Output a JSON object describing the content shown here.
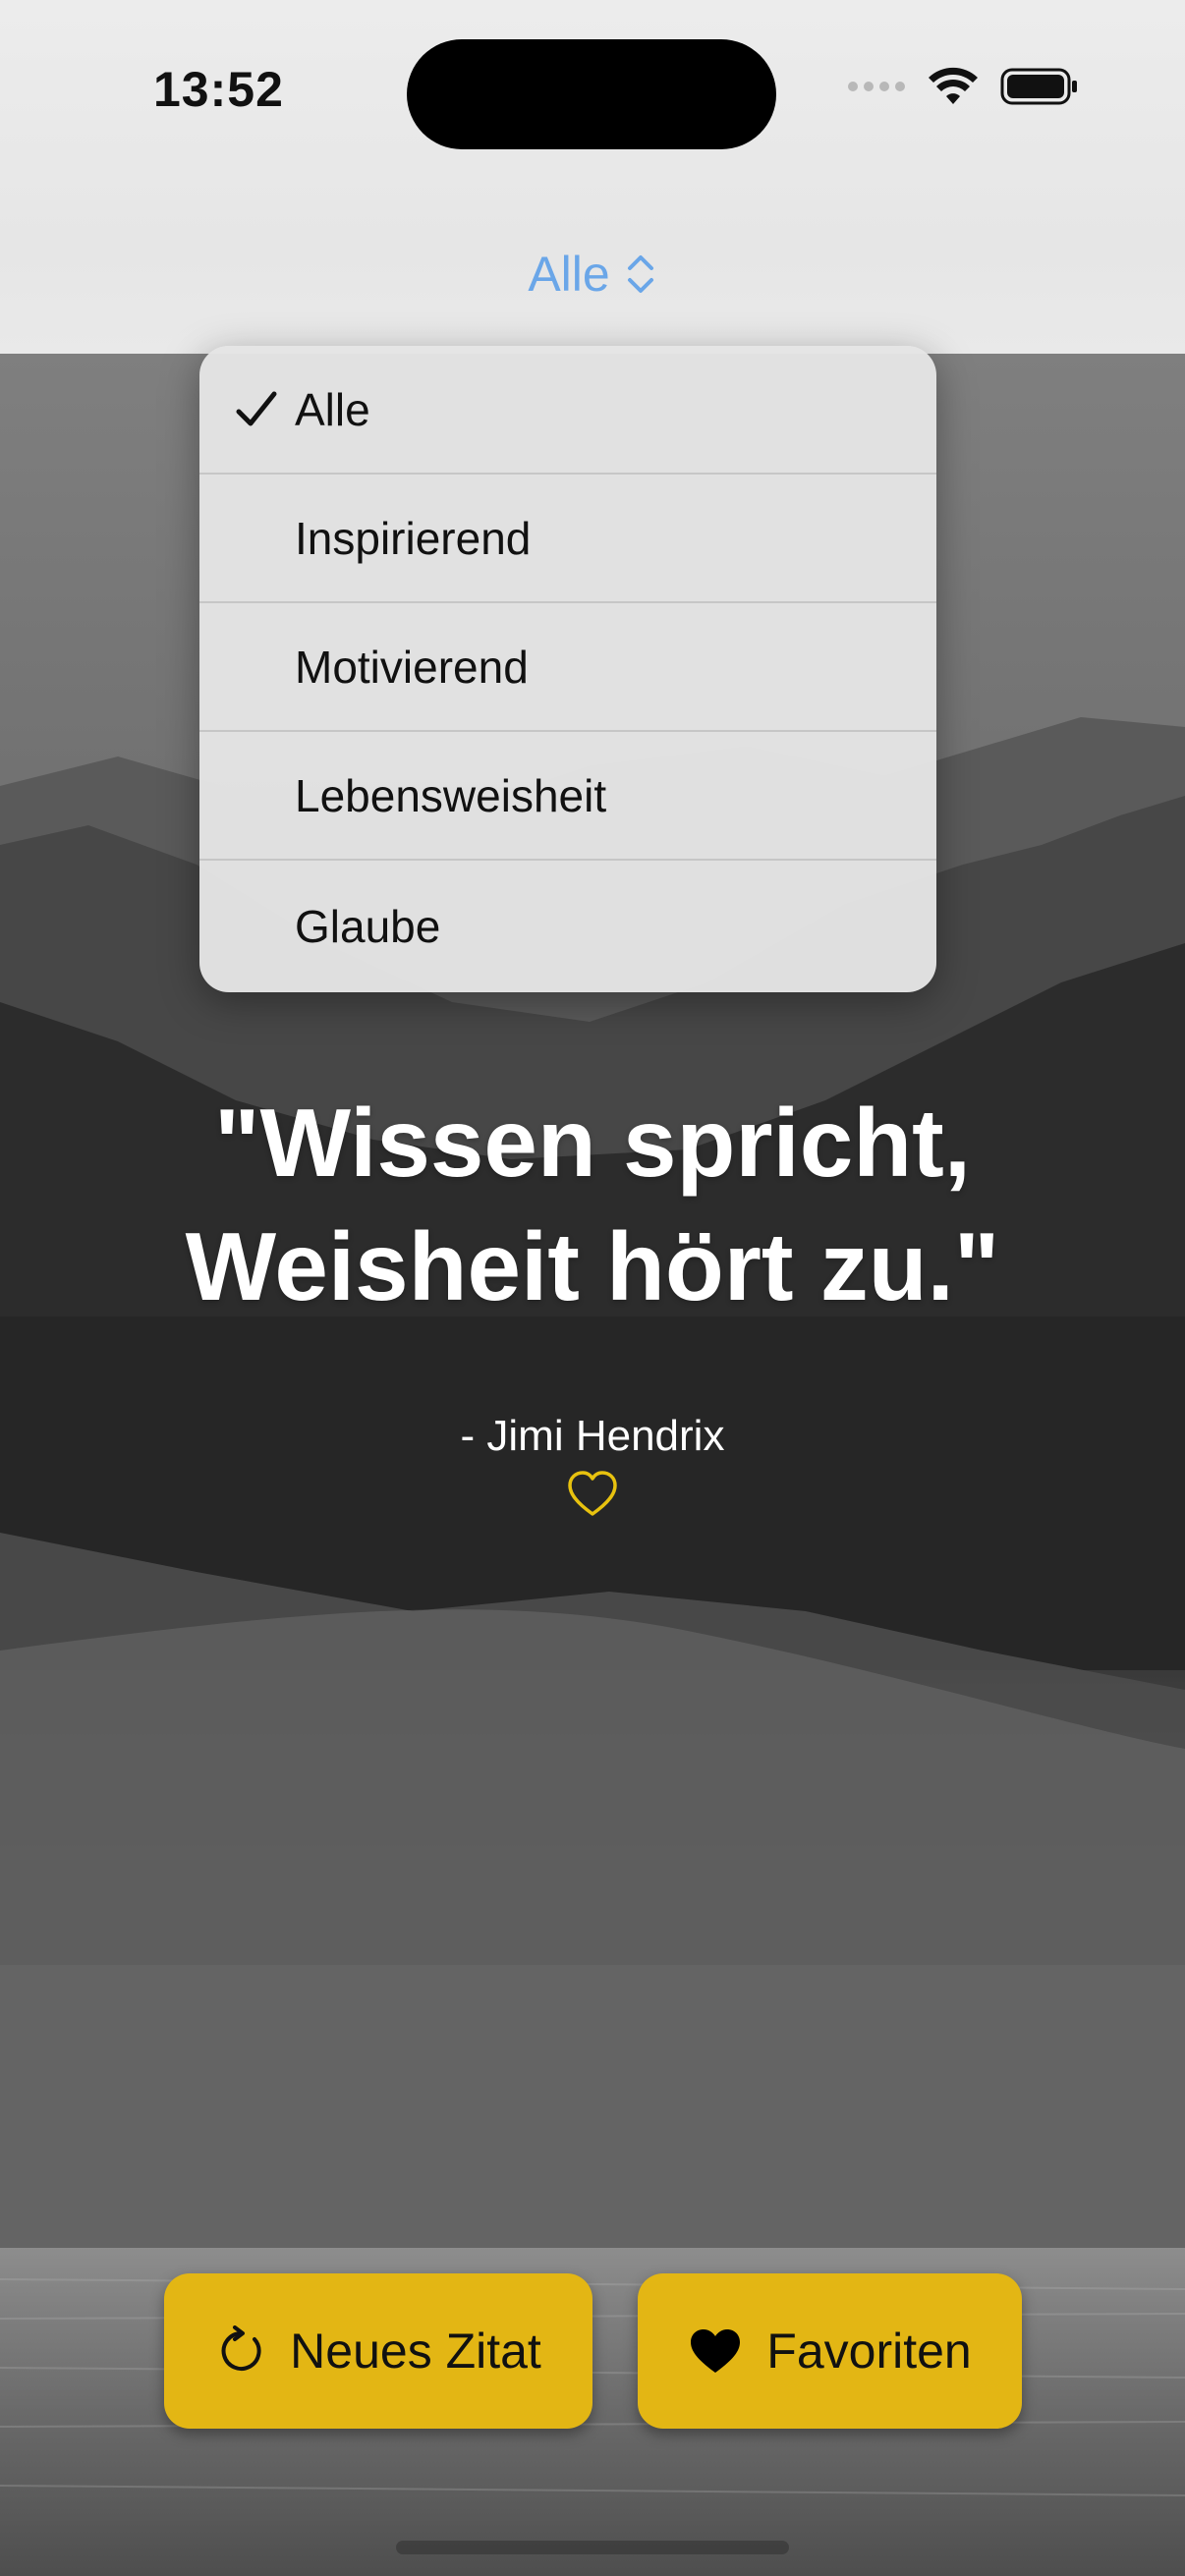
{
  "status_bar": {
    "time": "13:52"
  },
  "nav": {
    "picker_label": "Alle",
    "accent_color": "#6aa6e8"
  },
  "category_menu": {
    "selected": "Alle",
    "items": [
      {
        "label": "Alle",
        "checked": true
      },
      {
        "label": "Inspirierend",
        "checked": false
      },
      {
        "label": "Motivierend",
        "checked": false
      },
      {
        "label": "Lebensweisheit",
        "checked": false
      },
      {
        "label": "Glaube",
        "checked": false
      }
    ]
  },
  "quote": {
    "text": "\"Wissen spricht, Weisheit hört zu.\"",
    "author": "- Jimi Hendrix",
    "favorite": false,
    "heart_color": "#e8c20f"
  },
  "actions": {
    "new_quote_label": "Neues Zitat",
    "new_quote_icon": "refresh-icon",
    "favorites_label": "Favoriten",
    "favorites_icon": "heart-filled-icon",
    "button_color": "#e3b614"
  }
}
